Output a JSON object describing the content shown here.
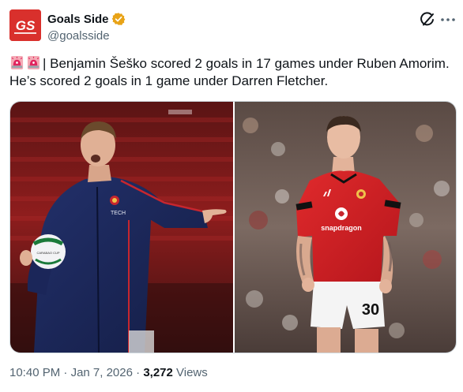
{
  "account": {
    "name": "Goals Side",
    "handle": "@goalsside",
    "avatar_text": "GS",
    "verified": true,
    "verified_color": "#e8a317",
    "brand_color": "#d9302c"
  },
  "post": {
    "prefix_icons": [
      "siren-icon",
      "siren-icon"
    ],
    "text_line1": "| Benjamin Šeško scored 2 goals in 17 games under Ruben Amorim.",
    "text_line2": "He’s scored 2 goals in 1 game under Darren Fletcher."
  },
  "media": {
    "left_photo": {
      "jacket_badge": "TECH",
      "ball_label": "CARABAO CUP"
    },
    "right_photo": {
      "sponsor": "snapdragon",
      "shirt_number": "30"
    }
  },
  "meta": {
    "time": "10:40 PM",
    "separator": " · ",
    "date": "Jan 7, 2026",
    "views_count": "3,272",
    "views_label": " Views"
  },
  "actions": {
    "grok_icon": "grok-icon",
    "more_icon": "more-icon"
  }
}
